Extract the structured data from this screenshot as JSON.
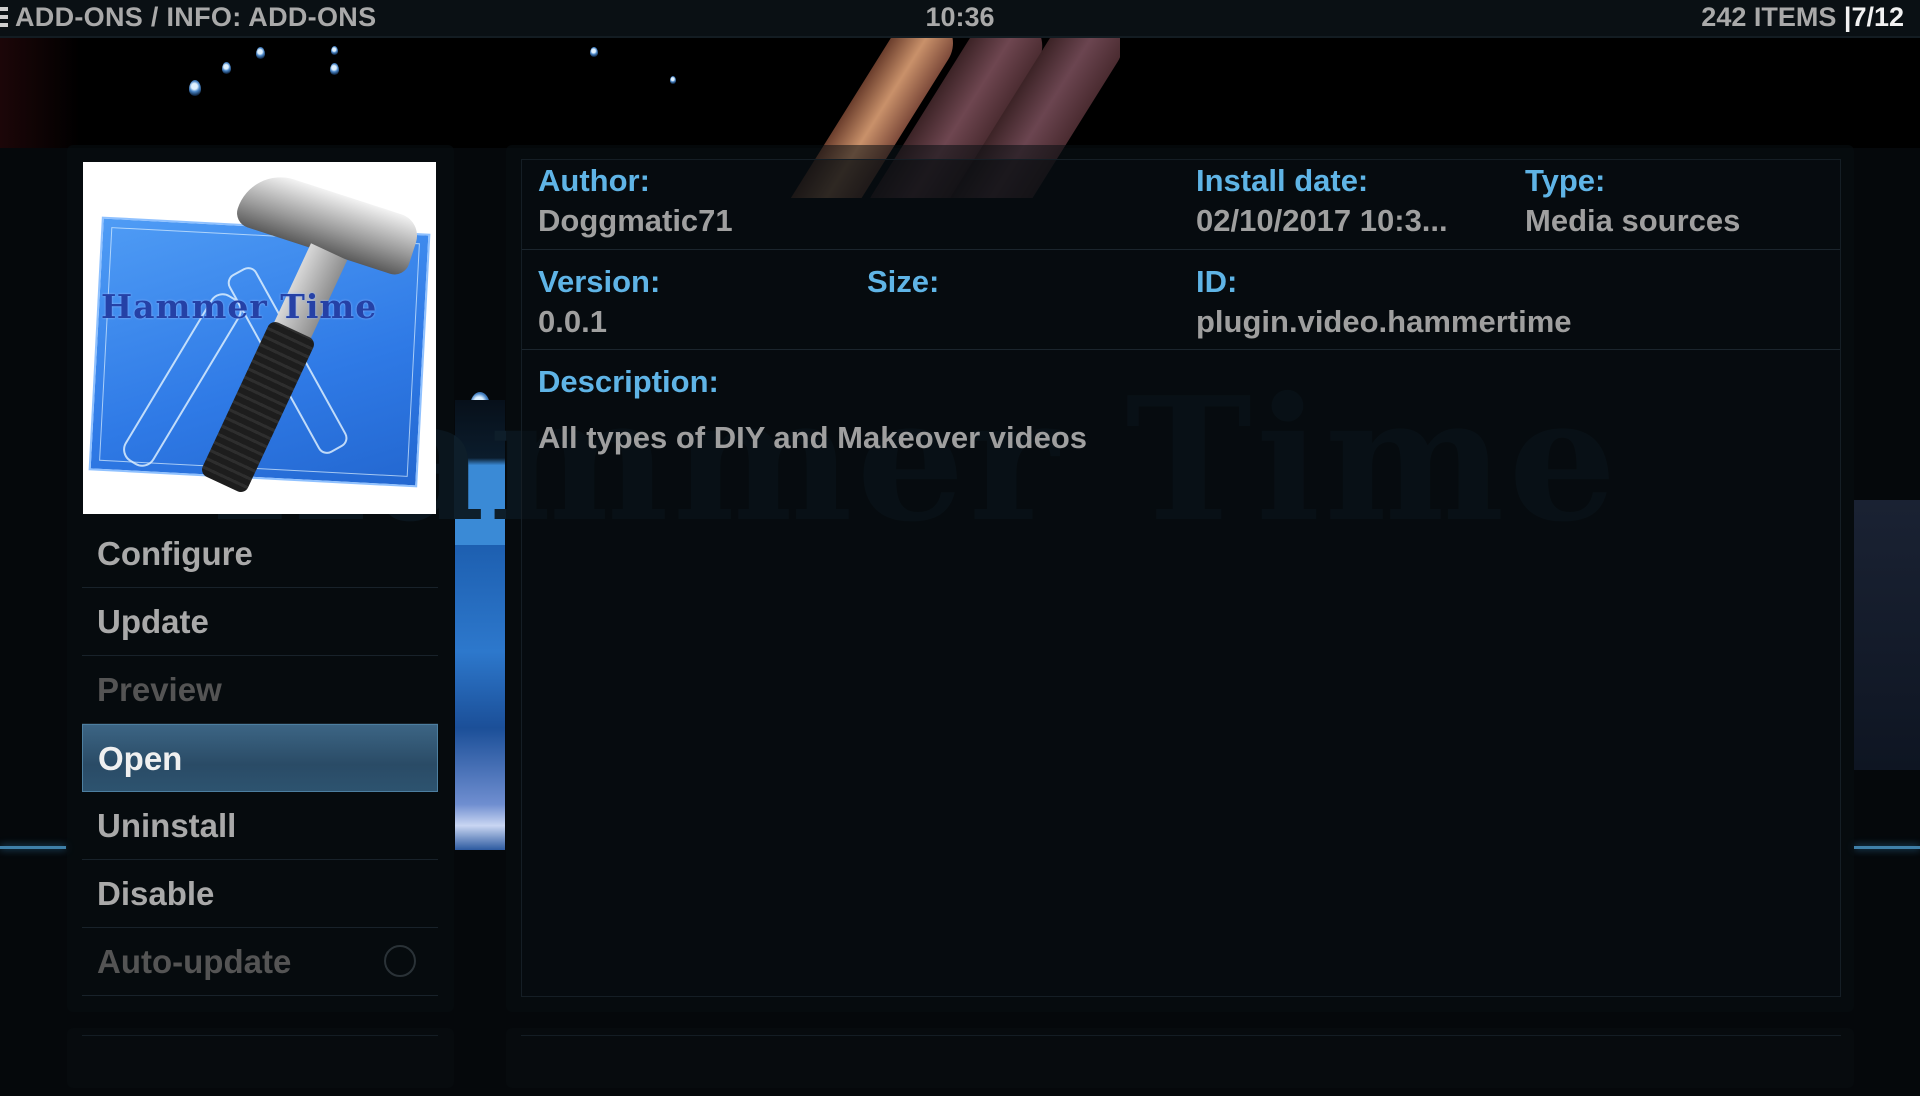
{
  "header": {
    "breadcrumb": "ADD-ONS / INFO: ADD-ONS",
    "clock": "10:36",
    "item_count": "242 ITEMS",
    "separator": "|",
    "page": "7/12"
  },
  "addon": {
    "thumbnail_title": "Hammer Time",
    "watermark": "Hammer Time"
  },
  "menu": {
    "items": [
      {
        "label": "Configure",
        "state": "enabled"
      },
      {
        "label": "Update",
        "state": "enabled"
      },
      {
        "label": "Preview",
        "state": "disabled"
      },
      {
        "label": "Open",
        "state": "focused"
      },
      {
        "label": "Uninstall",
        "state": "enabled"
      },
      {
        "label": "Disable",
        "state": "enabled"
      },
      {
        "label": "Auto-update",
        "state": "disabled",
        "toggle": "off"
      }
    ]
  },
  "details": {
    "author": {
      "label": "Author:",
      "value": "Doggmatic71"
    },
    "install_date": {
      "label": "Install date:",
      "value": "02/10/2017 10:3..."
    },
    "type": {
      "label": "Type:",
      "value": "Media sources"
    },
    "version": {
      "label": "Version:",
      "value": "0.0.1"
    },
    "size": {
      "label": "Size:",
      "value": ""
    },
    "id": {
      "label": "ID:",
      "value": "plugin.video.hammertime"
    },
    "description": {
      "label": "Description:",
      "value": "All types of DIY and Makeover videos"
    }
  },
  "colors": {
    "label_accent": "#5fb4e6",
    "value_text": "#9f9f9f",
    "focus_bg": "#2d536f"
  }
}
